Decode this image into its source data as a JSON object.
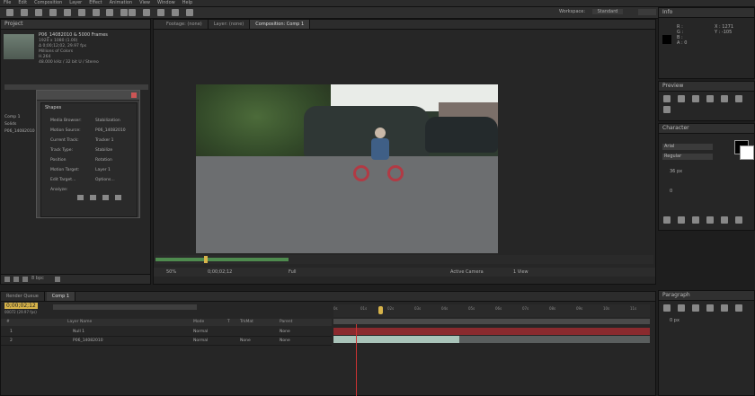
{
  "menubar": {
    "items": [
      "File",
      "Edit",
      "Composition",
      "Layer",
      "Effect",
      "Animation",
      "View",
      "Window",
      "Help"
    ]
  },
  "workspace": {
    "label": "Workspace:",
    "value": "Standard"
  },
  "project": {
    "title": "Project",
    "file_name": "P06_14082010 & 5000 Frames",
    "info_lines": [
      "1920 x 1080 (1.00)",
      "Δ 0;00;12;02, 29.97 fps",
      "Millions of Colors",
      "H.264",
      "48.000 kHz / 32 bit U / Stereo"
    ],
    "items": [
      "Comp 1",
      "Solids",
      "P06_14082010"
    ]
  },
  "dialog": {
    "title": "Shapes",
    "rows": [
      {
        "label": "Media Browser:",
        "value": "Stabilization"
      },
      {
        "label": "Motion Source:",
        "value": "P06_14082010"
      },
      {
        "label": "Current Track:",
        "value": "Tracker 1"
      },
      {
        "label": "Track Type:",
        "value": "Stabilize"
      },
      {
        "label": "Position",
        "value": "Rotation"
      },
      {
        "label": "Motion Target:",
        "value": "Layer 1"
      },
      {
        "label": "Edit Target...",
        "value": "Options..."
      },
      {
        "label": "Analyze:",
        "value": ""
      }
    ]
  },
  "viewer": {
    "tabs": [
      "Footage: (none)",
      "Layer: (none)",
      "Composition: Comp 1"
    ],
    "zoom": "50%",
    "timecode": "0;00;02;12",
    "view": "Full",
    "active_camera": "Active Camera",
    "views": "1 View"
  },
  "info": {
    "title": "Info",
    "r": "R :",
    "g": "G :",
    "b": "B :",
    "a": "A : 0",
    "x": "X : 1271",
    "y": "Y : -105"
  },
  "preview": {
    "title": "Preview"
  },
  "character": {
    "title": "Character",
    "font": "Arial",
    "style": "Regular",
    "size": "36 px",
    "tracking": "0"
  },
  "paragraph": {
    "title": "Paragraph",
    "indent": "0 px"
  },
  "timeline": {
    "tab": "Comp 1",
    "tab_render": "Render Queue",
    "timecode": "0;00;02;12",
    "frames": "00072 (29.97 fps)",
    "columns": [
      "#",
      "Layer Name",
      "Mode",
      "T",
      "TrkMat",
      "Parent"
    ],
    "layers": [
      {
        "num": "1",
        "name": "Null 1",
        "mode": "Normal",
        "trkmat": "",
        "parent": "None"
      },
      {
        "num": "2",
        "name": "P06_14082010",
        "mode": "Normal",
        "trkmat": "None",
        "parent": "None"
      }
    ],
    "ruler": [
      "0s",
      "01s",
      "02s",
      "03s",
      "04s",
      "05s",
      "06s",
      "07s",
      "08s",
      "09s",
      "10s",
      "11s"
    ]
  },
  "colors": {
    "bg": "#1e1e1e",
    "panel": "#262626",
    "accent": "#d7b34a",
    "layer_red": "#8a2a2e",
    "layer_teal": "#a9c3b9"
  }
}
